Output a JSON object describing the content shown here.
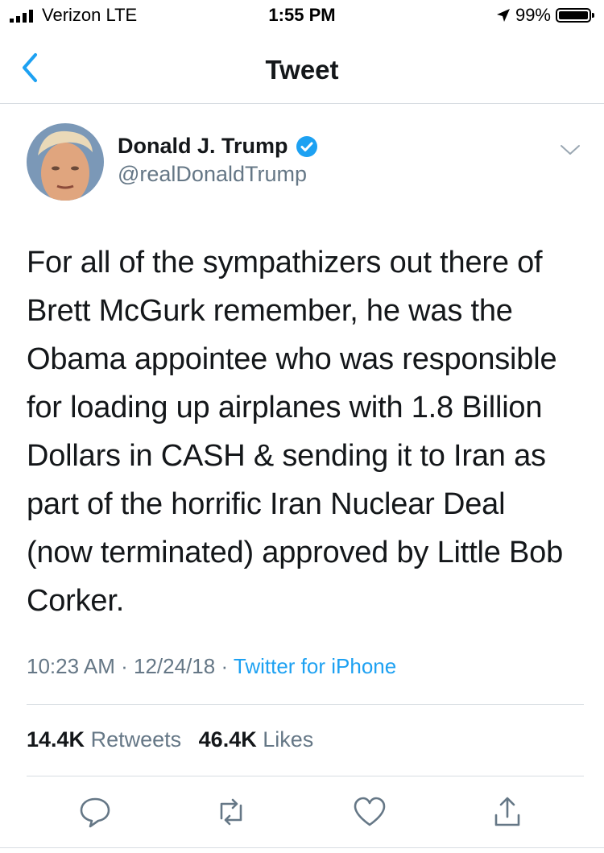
{
  "status_bar": {
    "carrier": "Verizon  LTE",
    "time": "1:55 PM",
    "battery": "99%",
    "battery_level": 0.99
  },
  "nav": {
    "title": "Tweet",
    "back_icon": "chevron-left-icon"
  },
  "author": {
    "name": "Donald J. Trump",
    "handle": "@realDonaldTrump",
    "verified": true
  },
  "tweet": {
    "text": "For all of the sympathizers out there of\nBrett McGurk remember, he was the\nObama appointee who was responsible\nfor loading up airplanes with 1.8 Billion\nDollars in CASH &  sending it to Iran as\npart of the horrific Iran Nuclear Deal\n(now terminated) approved by Little Bob\nCorker.",
    "time": "10:23 AM",
    "date": "12/24/18",
    "separator": "·",
    "source": "Twitter for iPhone"
  },
  "stats": {
    "retweets_count": "14.4K",
    "retweets_label": "Retweets",
    "likes_count": "46.4K",
    "likes_label": "Likes"
  },
  "colors": {
    "link": "#1da1f2",
    "muted": "#657786",
    "text": "#14171a",
    "divider": "#d8dde2"
  },
  "actions": [
    "reply-icon",
    "retweet-icon",
    "like-icon",
    "share-icon"
  ]
}
